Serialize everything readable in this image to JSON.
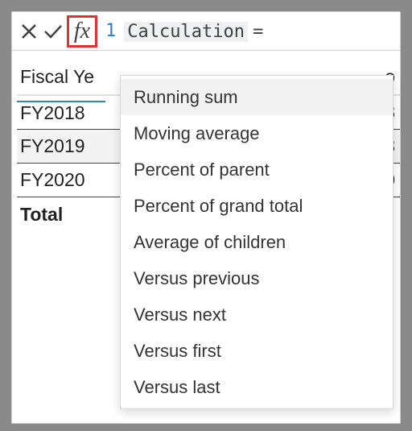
{
  "formula_bar": {
    "line_number": "1",
    "token": "Calculation",
    "equals": "="
  },
  "grid": {
    "col_header_left": "Fiscal Ye",
    "col_header_right_fragment": "o",
    "rows": [
      {
        "label": "FY2018",
        "value_fragment": "8"
      },
      {
        "label": "FY2019",
        "value_fragment": "3"
      },
      {
        "label": "FY2020",
        "value_fragment": "0"
      }
    ],
    "total_label": "Total",
    "total_value_fragment": ":"
  },
  "dropdown": {
    "items": [
      "Running sum",
      "Moving average",
      "Percent of parent",
      "Percent of grand total",
      "Average of children",
      "Versus previous",
      "Versus next",
      "Versus first",
      "Versus last"
    ]
  }
}
